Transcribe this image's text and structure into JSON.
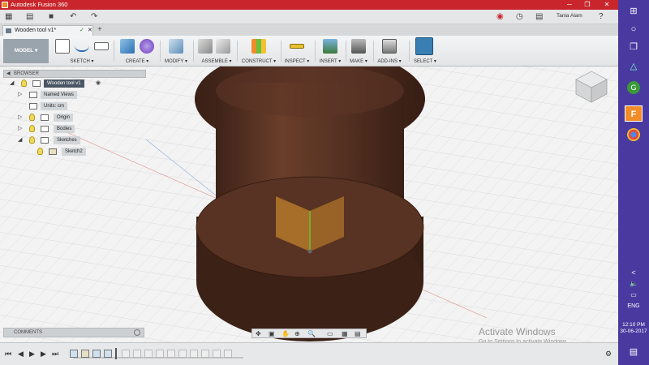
{
  "window": {
    "title": "Autodesk Fusion 360",
    "minimize_glyph": "─",
    "restore_glyph": "❐",
    "close_glyph": "✕"
  },
  "qat": {
    "user_name": "Tania Alam",
    "grid_glyph": "▦",
    "file_glyph": "▤",
    "save_glyph": "■",
    "undo_glyph": "↶",
    "redo_glyph": "↷",
    "record_glyph": "◉",
    "clock_glyph": "◷",
    "help_glyph": "?"
  },
  "tabs": {
    "doc_title": "Wooden tool v1*",
    "saved_glyph": "✓",
    "close_glyph": "✕",
    "new_tab_glyph": "+"
  },
  "ribbon": {
    "workspace": "MODEL ▾",
    "groups": [
      "SKETCH ▾",
      "CREATE ▾",
      "MODIFY ▾",
      "ASSEMBLE ▾",
      "CONSTRUCT ▾",
      "INSPECT ▾",
      "INSERT ▾",
      "MAKE ▾",
      "ADD-INS ▾",
      "SELECT ▾"
    ]
  },
  "browser": {
    "header": "BROWSER",
    "items": [
      {
        "label": "Wooden tool v1"
      },
      {
        "label": "Named Views"
      },
      {
        "label": "Units: cm"
      },
      {
        "label": "Origin"
      },
      {
        "label": "Bodies"
      },
      {
        "label": "Sketches"
      },
      {
        "label": "Sketch2"
      }
    ]
  },
  "comments": {
    "label": "COMMENTS"
  },
  "navbar": {
    "glyphs": [
      "✥",
      "▣",
      "✋",
      "⊕",
      "🔍",
      "▭",
      "▦",
      "▤"
    ]
  },
  "timeline": {
    "controls": [
      "⏮",
      "◀",
      "▶",
      "▶",
      "⏭"
    ],
    "settings_glyph": "⚙"
  },
  "watermark": {
    "line1": "Activate Windows",
    "line2": "Go to Settings to activate Windows."
  },
  "taskbar": {
    "language": "ENG",
    "time": "12:10 PM",
    "date": "30-06-2017",
    "notification_glyph": "▤",
    "chevron_glyph": "<",
    "volume_glyph": "🔈",
    "network_glyph": "▭"
  },
  "colors": {
    "titlebar": "#c8262c",
    "taskbar": "#4a3aa0",
    "wood": "#5a3424",
    "accent_orange": "#f28c28"
  }
}
